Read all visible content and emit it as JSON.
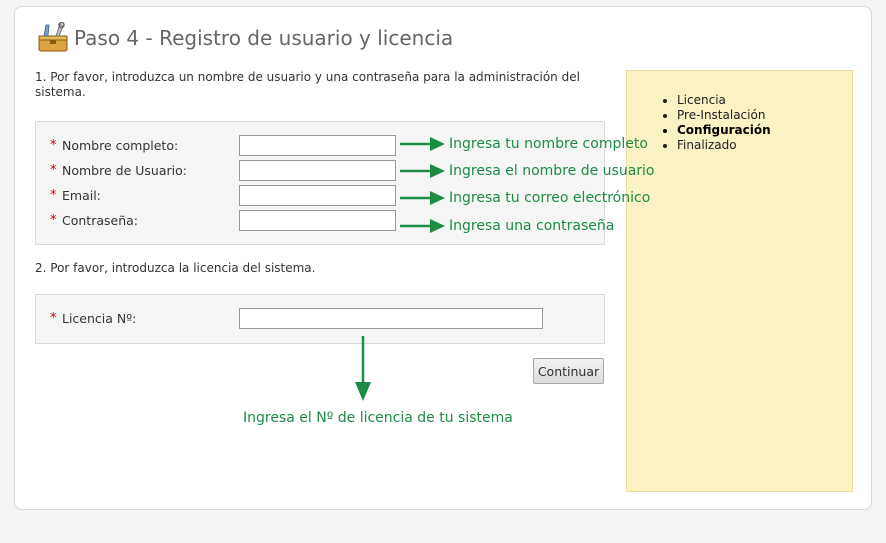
{
  "header": {
    "title": "Paso 4 - Registro de usuario y licencia",
    "icon": "toolbox-icon"
  },
  "section1": {
    "intro": "1. Por favor, introduzca un nombre de usuario y una contraseña para la administración del sistema."
  },
  "fields": [
    {
      "required": "*",
      "label": "Nombre completo:",
      "value": "",
      "annotation": "Ingresa tu nombre completo"
    },
    {
      "required": "*",
      "label": "Nombre de Usuario:",
      "value": "",
      "annotation": "Ingresa el nombre de usuario"
    },
    {
      "required": "*",
      "label": "Email:",
      "value": "",
      "annotation": "Ingresa tu correo electrónico"
    },
    {
      "required": "*",
      "label": "Contraseña:",
      "value": "",
      "annotation": "Ingresa una contraseña"
    }
  ],
  "section2": {
    "intro": "2. Por favor, introduzca la licencia del sistema.",
    "license": {
      "required": "*",
      "label": "Licencia Nº:",
      "value": "",
      "annotation": "Ingresa el Nº de licencia de tu sistema"
    }
  },
  "continue_label": "Continuar",
  "sidebar": {
    "steps": [
      {
        "label": "Licencia",
        "active": false
      },
      {
        "label": "Pre-Instalación",
        "active": false
      },
      {
        "label": "Configuración",
        "active": true
      },
      {
        "label": "Finalizado",
        "active": false
      }
    ]
  },
  "colors": {
    "annotation": "#1c8c45",
    "required": "#cc0000",
    "sidebar_bg": "#fbf2c4"
  }
}
